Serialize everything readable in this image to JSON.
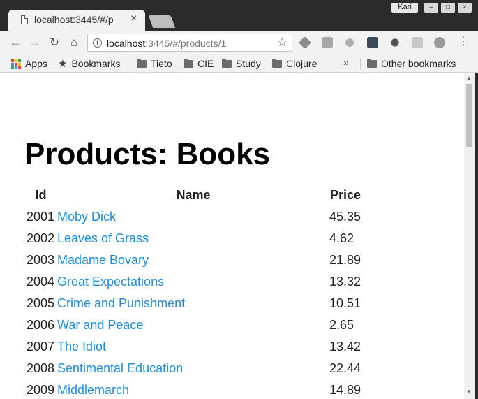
{
  "tab": {
    "title": "localhost:3445/#/p",
    "close": "×"
  },
  "window": {
    "user": "Kari",
    "minimize": "–",
    "maximize": "□",
    "close": "×"
  },
  "toolbar": {
    "back": "←",
    "forward": "→",
    "reload": "↻",
    "home": "⌂",
    "url_host": "localhost",
    "url_rest": ":3445/#/products/1",
    "info": "i",
    "star": "☆",
    "menu": "⋮"
  },
  "bookmarks": {
    "apps": "Apps",
    "bookmarks": "Bookmarks",
    "folders": [
      "Tieto",
      "CIE",
      "Study",
      "Clojure"
    ],
    "overflow": "»",
    "other": "Other bookmarks"
  },
  "page": {
    "title": "Products: Books",
    "columns": {
      "id": "Id",
      "name": "Name",
      "price": "Price"
    },
    "products": [
      {
        "id": "2001",
        "name": "Moby Dick",
        "price": "45.35"
      },
      {
        "id": "2002",
        "name": "Leaves of Grass",
        "price": "4.62"
      },
      {
        "id": "2003",
        "name": "Madame Bovary",
        "price": "21.89"
      },
      {
        "id": "2004",
        "name": "Great Expectations",
        "price": "13.32"
      },
      {
        "id": "2005",
        "name": "Crime and Punishment",
        "price": "10.51"
      },
      {
        "id": "2006",
        "name": "War and Peace",
        "price": "2.65"
      },
      {
        "id": "2007",
        "name": "The Idiot",
        "price": "13.42"
      },
      {
        "id": "2008",
        "name": "Sentimental Education",
        "price": "22.44"
      },
      {
        "id": "2009",
        "name": "Middlemarch",
        "price": "14.89"
      }
    ]
  },
  "colors": {
    "link": "#1a8fe3",
    "chrome_dark": "#2b2b2b",
    "toolbar": "#f2f2f2"
  }
}
